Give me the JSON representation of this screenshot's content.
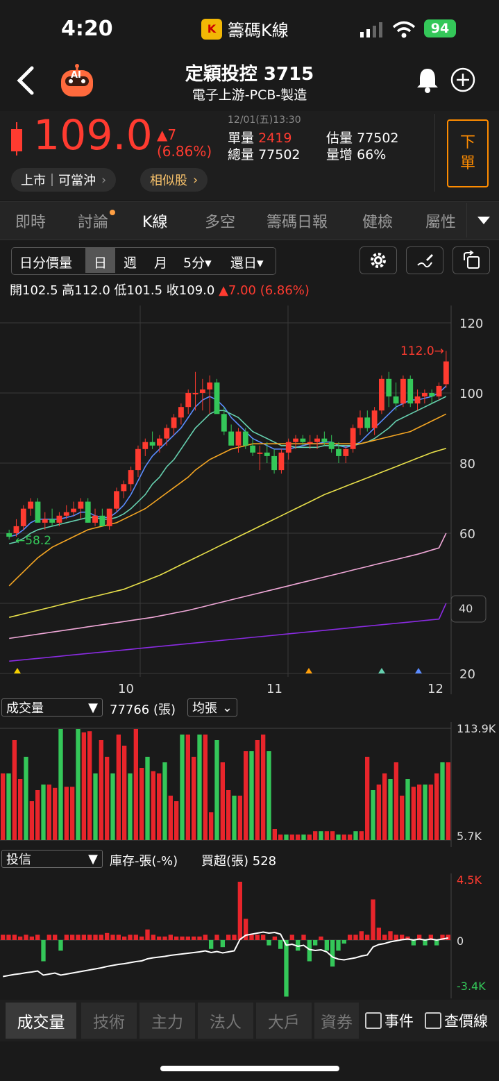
{
  "status_bar": {
    "time": "4:20",
    "app_title": "籌碼K線",
    "battery": "94"
  },
  "header": {
    "stock_name": "定穎投控 3715",
    "industry": "電子上游-PCB-製造",
    "ai_badge": "AI"
  },
  "quote": {
    "price": "109.0",
    "change": "▲7",
    "change_pct": "(6.86%)",
    "timestamp": "12/01(五)13:30",
    "unit_vol_label": "單量",
    "unit_vol": "2419",
    "est_vol_label": "估量",
    "est_vol": "77502",
    "total_vol_label": "總量",
    "total_vol": "77502",
    "vol_inc_label": "量增",
    "vol_inc": "66%",
    "sell_button": [
      "下",
      "單"
    ],
    "market_pill": "上市｜可當沖",
    "similar_pill": "相似股"
  },
  "tabs": [
    "即時",
    "討論",
    "K線",
    "多空",
    "籌碼日報",
    "健檢",
    "屬性"
  ],
  "active_tab": "K線",
  "toolbar": {
    "periods": [
      "日分價量",
      "日",
      "週",
      "月",
      "5分▾",
      "還日▾"
    ],
    "active_period": "日"
  },
  "ohlc": {
    "open_label": "開",
    "open": "102.5",
    "high_label": "高",
    "high": "112.0",
    "low_label": "低",
    "low": "101.5",
    "close_label": "收",
    "close": "109.0",
    "change": "▲7.00 (6.86%)"
  },
  "chart_data": [
    {
      "type": "candlestick",
      "y_ticks": [
        "120",
        "100",
        "80",
        "60",
        "40",
        "20"
      ],
      "ylim": [
        20,
        120
      ],
      "x_labels": [
        "10",
        "11",
        "12"
      ],
      "high_marker": "112.0→",
      "low_marker": "←58.2",
      "candles": [
        [
          60,
          61,
          58.2,
          59
        ],
        [
          60,
          64,
          59,
          62
        ],
        [
          62,
          68,
          61,
          67
        ],
        [
          67,
          70,
          65,
          69
        ],
        [
          69,
          70,
          63,
          63
        ],
        [
          63,
          66,
          61,
          64
        ],
        [
          64,
          67,
          62,
          63
        ],
        [
          63,
          66,
          62,
          65
        ],
        [
          65,
          68,
          64,
          66
        ],
        [
          66,
          69,
          65,
          67
        ],
        [
          67,
          70,
          64,
          69
        ],
        [
          69,
          70,
          63,
          63
        ],
        [
          63,
          67,
          62,
          65
        ],
        [
          65,
          67,
          62,
          62
        ],
        [
          62,
          67,
          61,
          67
        ],
        [
          67,
          73,
          66,
          72
        ],
        [
          72,
          75,
          70,
          74
        ],
        [
          74,
          79,
          72,
          78
        ],
        [
          78,
          85,
          76,
          84
        ],
        [
          84,
          87,
          82,
          86
        ],
        [
          86,
          89,
          84,
          85
        ],
        [
          85,
          88,
          83,
          87
        ],
        [
          87,
          91,
          85,
          90
        ],
        [
          90,
          94,
          88,
          93
        ],
        [
          93,
          97,
          91,
          96
        ],
        [
          96,
          101,
          94,
          100
        ],
        [
          100,
          106,
          95,
          100
        ],
        [
          100,
          104,
          95,
          101
        ],
        [
          101,
          105,
          94,
          103
        ],
        [
          103,
          104,
          95,
          94
        ],
        [
          94,
          96,
          88,
          89
        ],
        [
          89,
          91,
          86,
          85
        ],
        [
          85,
          90,
          83,
          89
        ],
        [
          89,
          90,
          84,
          85
        ],
        [
          85,
          87,
          82,
          83
        ],
        [
          83,
          85,
          78,
          83
        ],
        [
          83,
          86,
          80,
          82
        ],
        [
          82,
          84,
          77,
          78
        ],
        [
          78,
          84,
          77,
          83
        ],
        [
          83,
          87,
          81,
          86
        ],
        [
          86,
          88,
          84,
          87
        ],
        [
          87,
          88,
          85,
          86
        ],
        [
          86,
          88,
          84,
          86
        ],
        [
          86,
          88,
          84,
          87
        ],
        [
          87,
          89,
          85,
          86
        ],
        [
          86,
          88,
          83,
          84
        ],
        [
          84,
          86,
          80,
          82
        ],
        [
          82,
          85,
          80,
          84
        ],
        [
          84,
          91,
          83,
          90
        ],
        [
          90,
          95,
          88,
          93
        ],
        [
          93,
          95,
          89,
          90
        ],
        [
          90,
          96,
          88,
          95
        ],
        [
          95,
          105,
          94,
          104
        ],
        [
          104,
          106,
          96,
          99
        ],
        [
          99,
          103,
          95,
          97
        ],
        [
          97,
          105,
          96,
          104
        ],
        [
          104,
          105,
          96,
          97
        ],
        [
          97,
          101,
          95,
          99
        ],
        [
          99,
          101,
          97,
          100
        ],
        [
          100,
          101,
          97,
          99
        ],
        [
          99,
          103,
          98,
          102
        ],
        [
          102.5,
          112,
          101.5,
          109
        ]
      ],
      "ma_lines": [
        {
          "color": "#5b8cff",
          "values": [
            59,
            59.5,
            61,
            63,
            64,
            64,
            64,
            64,
            64.5,
            65,
            66,
            66,
            65,
            64.5,
            64.5,
            66,
            68,
            71,
            75,
            79,
            82,
            84,
            86,
            88,
            90,
            93,
            96,
            98,
            99,
            98,
            96,
            93,
            91,
            89,
            87,
            86,
            85,
            84,
            84,
            84,
            84.5,
            85,
            85.5,
            85.5,
            86,
            86,
            85,
            84.5,
            85,
            86,
            88,
            90,
            92,
            94,
            96,
            97,
            98,
            98,
            98.5,
            99,
            100,
            102
          ]
        },
        {
          "color": "#66d1b0",
          "values": [
            57,
            57.5,
            58.5,
            60,
            61,
            61.5,
            62,
            62.5,
            63,
            63.5,
            64,
            64.5,
            64.5,
            64,
            64,
            64.5,
            65.5,
            67,
            69,
            71,
            74,
            76,
            79,
            81,
            84,
            87,
            90,
            92,
            94,
            95,
            95,
            94,
            93,
            91,
            89,
            88,
            87,
            86,
            85,
            85,
            84.5,
            84.5,
            84.5,
            84.5,
            85,
            85,
            85,
            85,
            85,
            85.5,
            86,
            87,
            88.5,
            90,
            92,
            93,
            94,
            95,
            96,
            97,
            98,
            99
          ]
        },
        {
          "color": "#f5a623",
          "values": [
            45,
            47,
            49,
            51,
            53,
            54.5,
            56,
            57,
            58,
            59,
            60,
            61,
            61.5,
            62,
            62.5,
            63,
            64,
            65,
            66,
            67,
            68.5,
            70,
            71.5,
            73,
            74.5,
            76,
            78,
            79.5,
            81,
            82,
            83,
            84,
            84.5,
            85,
            85.5,
            85.5,
            85.5,
            85.5,
            85.5,
            85.5,
            85.5,
            85.5,
            85.5,
            85.5,
            85.5,
            85.5,
            85.5,
            85.5,
            85.5,
            85.5,
            86,
            86.5,
            87,
            87.5,
            88,
            88.5,
            89,
            90,
            91,
            92,
            93,
            94
          ]
        },
        {
          "color": "#e8e04a",
          "values": [
            36,
            36.5,
            37,
            37.5,
            38,
            38.5,
            39,
            39.5,
            40,
            40.5,
            41,
            41.5,
            42,
            42.5,
            43,
            43.5,
            44,
            44.8,
            45.6,
            46.4,
            47.2,
            48,
            49,
            50,
            51,
            52,
            53,
            54,
            55,
            56,
            57,
            58,
            59,
            60,
            61,
            62,
            63,
            64,
            65,
            66,
            67,
            68,
            69,
            70,
            71,
            71.8,
            72.6,
            73.4,
            74.2,
            75,
            75.8,
            76.6,
            77.4,
            78.2,
            79,
            79.8,
            80.6,
            81.4,
            82.2,
            83,
            83.6,
            84.2
          ]
        },
        {
          "color": "#f0a8d8",
          "values": [
            30,
            30.3,
            30.6,
            30.9,
            31.2,
            31.5,
            31.8,
            32.1,
            32.4,
            32.7,
            33,
            33.3,
            33.6,
            33.9,
            34.2,
            34.5,
            34.8,
            35.1,
            35.4,
            35.7,
            36,
            36.4,
            36.8,
            37.2,
            37.6,
            38,
            38.5,
            39,
            39.5,
            40,
            40.5,
            41,
            41.5,
            42,
            42.5,
            43,
            43.5,
            44,
            44.5,
            45,
            45.5,
            46,
            46.5,
            47,
            47.5,
            48,
            48.5,
            49,
            49.5,
            50,
            50.5,
            51,
            51.5,
            52,
            52.5,
            53,
            53.5,
            54,
            54.6,
            55.2,
            55.8,
            60
          ]
        },
        {
          "color": "#8a2be2",
          "values": [
            23.5,
            23.7,
            23.9,
            24.1,
            24.3,
            24.5,
            24.7,
            24.9,
            25.1,
            25.3,
            25.5,
            25.7,
            25.9,
            26.1,
            26.3,
            26.5,
            26.7,
            26.9,
            27.1,
            27.3,
            27.5,
            27.7,
            27.9,
            28.1,
            28.3,
            28.5,
            28.7,
            28.9,
            29.1,
            29.3,
            29.5,
            29.7,
            29.9,
            30.1,
            30.3,
            30.5,
            30.7,
            30.9,
            31.1,
            31.3,
            31.5,
            31.7,
            31.9,
            32.1,
            32.3,
            32.5,
            32.7,
            32.9,
            33.1,
            33.3,
            33.5,
            33.7,
            33.9,
            34.1,
            34.3,
            34.5,
            34.7,
            34.9,
            35.1,
            35.3,
            35.5,
            40
          ]
        }
      ]
    },
    {
      "type": "bar",
      "title": "成交量",
      "value_text": "77766 (張)",
      "mode": "均張",
      "ylim_labels": [
        "113.9K",
        "5.7K"
      ],
      "values": [
        60,
        60,
        90,
        55,
        75,
        35,
        45,
        50,
        50,
        47,
        100,
        48,
        48,
        100,
        97,
        98,
        60,
        90,
        75,
        60,
        95,
        85,
        60,
        100,
        65,
        75,
        62,
        60,
        70,
        40,
        35,
        95,
        95,
        75,
        95,
        95,
        25,
        90,
        70,
        45,
        40,
        40,
        80,
        80,
        90,
        95,
        80,
        10,
        5,
        5,
        5,
        5,
        5,
        5,
        8,
        8,
        8,
        8,
        5,
        5,
        5,
        8,
        8,
        75,
        45,
        50,
        60,
        55,
        70,
        40,
        55,
        48,
        50,
        50,
        50,
        60,
        70,
        70
      ]
    },
    {
      "type": "bar",
      "title": "投信",
      "subtitle": "庫存-張(-%)",
      "value_text": "買超(張) 528",
      "ylim_labels": [
        "4.5K",
        "0",
        "-3.4K"
      ]
    }
  ],
  "inst_values": [
    0.3,
    0.3,
    0.3,
    0.2,
    0.3,
    0.2,
    0.3,
    -1.2,
    0.3,
    0.3,
    -0.6,
    0.3,
    0.3,
    0.3,
    0.3,
    0.3,
    0.3,
    0.3,
    0.4,
    0.3,
    0.3,
    0.2,
    0.3,
    0.3,
    0.2,
    0.6,
    0.3,
    0.2,
    0.2,
    0.3,
    0.2,
    0.2,
    0.2,
    0.2,
    0.2,
    0.3,
    -0.5,
    0.3,
    -0.4,
    0.3,
    0.3,
    3.3,
    1.2,
    0.3,
    0.3,
    0.3,
    -0.3,
    0.2,
    -0.5,
    -3.2,
    0.3,
    -0.6,
    0.3,
    -1.2,
    -0.3,
    0.2,
    -0.6,
    -1.5,
    -0.6,
    -0.2,
    0.3,
    0.3,
    0.5,
    0.3,
    2.3,
    0.7,
    0.3,
    0.5,
    0.3,
    0.3,
    0.2,
    -0.3,
    0.3,
    -0.3,
    0.3,
    -0.3,
    0.3,
    0.3
  ],
  "bottom_tabs": [
    "成交量",
    "技術",
    "主力",
    "法人",
    "大戶",
    "資券"
  ],
  "checkboxes": [
    "事件",
    "查價線"
  ]
}
